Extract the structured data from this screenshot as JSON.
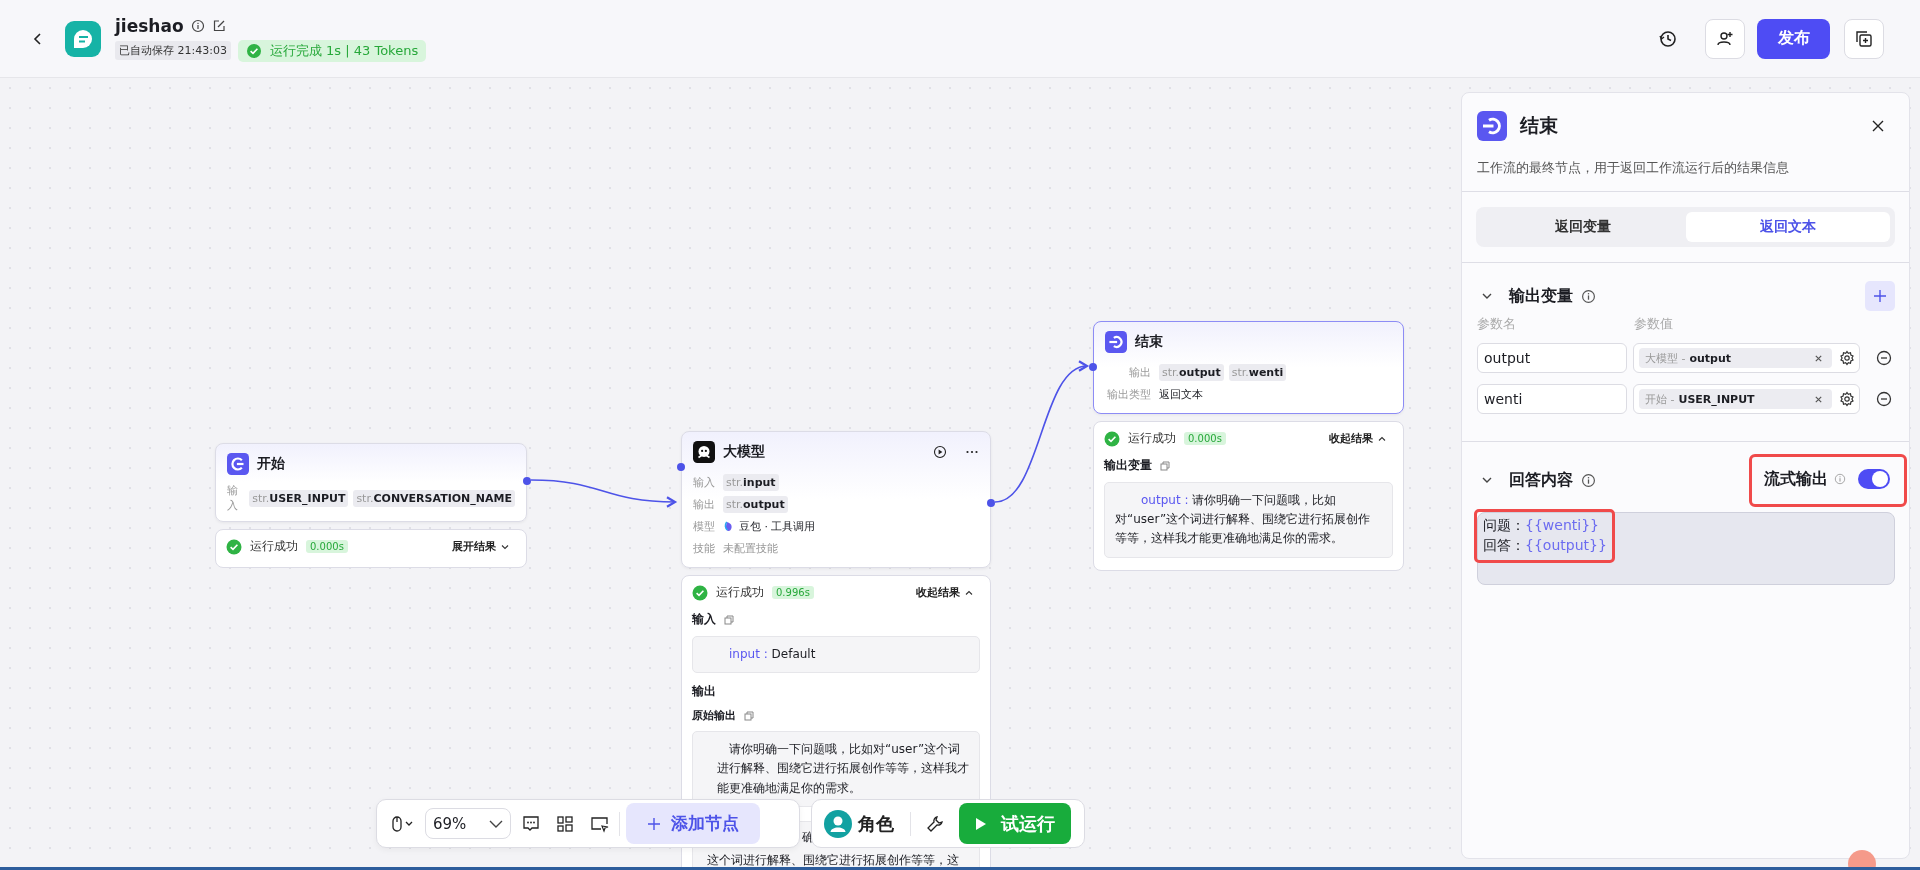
{
  "header": {
    "title": "jieshao",
    "autosave": "已自动保存 21:43:03",
    "run_status": "运行完成 1s | 43 Tokens",
    "publish": "发布"
  },
  "nodes": [
    {
      "kind": "start",
      "title": "开始",
      "rows": [
        {
          "label": "输入",
          "kind": "tags",
          "tags": [
            {
              "prefix": "str.",
              "name": "USER_INPUT"
            },
            {
              "prefix": "str.",
              "name": "CONVERSATION_NAME"
            }
          ]
        }
      ],
      "result": {
        "status": "运行成功",
        "time": "0.000s",
        "toggle": "展开结果",
        "expanded": false
      }
    },
    {
      "kind": "llm",
      "title": "大模型",
      "rows": [
        {
          "label": "输入",
          "kind": "tags",
          "tags": [
            {
              "prefix": "str.",
              "name": "input"
            }
          ]
        },
        {
          "label": "输出",
          "kind": "tags",
          "tags": [
            {
              "prefix": "str.",
              "name": "output"
            }
          ]
        },
        {
          "label": "模型",
          "kind": "model",
          "text": "豆包 · 工具调用"
        },
        {
          "label": "技能",
          "kind": "empty",
          "text": "未配置技能"
        }
      ],
      "result": {
        "status": "运行成功",
        "time": "0.996s",
        "toggle": "收起结果",
        "expanded": true,
        "sections": [
          {
            "heading": "输入",
            "kind": "kv",
            "key": "input :",
            "value": "Default"
          },
          {
            "heading": "输出",
            "kind": "raw",
            "subheading": "原始输出",
            "text": "请你明确一下问题哦，比如对“user”这个词进行解释、围绕它进行拓展创作等等，这样我才能更准确地满足你的需求。"
          }
        ],
        "tail": {
          "fragment": "确",
          "text": "这个词进行解释、围绕它进行拓展创作等等，这"
        }
      }
    },
    {
      "kind": "end",
      "title": "结束",
      "rows": [
        {
          "label": "输出",
          "kind": "tags",
          "tags": [
            {
              "prefix": "str.",
              "name": "output"
            },
            {
              "prefix": "str.",
              "name": "wenti"
            }
          ]
        },
        {
          "label": "输出类型",
          "kind": "text",
          "text": "返回文本"
        }
      ],
      "result": {
        "status": "运行成功",
        "time": "0.000s",
        "toggle": "收起结果",
        "expanded": true,
        "sections": [
          {
            "heading": "输出变量",
            "kind": "kv",
            "key": "output :",
            "value": "请你明确一下问题哦，比如对“user”这个词进行解释、围绕它进行拓展创作等等，这样我才能更准确地满足你的需求。"
          }
        ]
      }
    }
  ],
  "panel": {
    "title": "结束",
    "description": "工作流的最终节点，用于返回工作流运行后的结果信息",
    "tabs": [
      {
        "label": "返回变量",
        "selected": false
      },
      {
        "label": "返回文本",
        "selected": true
      }
    ],
    "output_section": {
      "title": "输出变量",
      "expanded": true,
      "columns": [
        "参数名",
        "参数值"
      ],
      "rows": [
        {
          "name": "output",
          "source": "大模型 -",
          "variable": "output"
        },
        {
          "name": "wenti",
          "source": "开始 -",
          "variable": "USER_INPUT"
        }
      ]
    },
    "answer_section": {
      "title": "回答内容",
      "expanded": true,
      "highlighted": true,
      "streaming": {
        "label": "流式输出",
        "on": true,
        "highlighted": true
      },
      "lines": [
        {
          "label": "问题：",
          "variable": "{{wenti}}"
        },
        {
          "label": "回答：",
          "variable": "{{output}}"
        }
      ]
    }
  },
  "toolbar": {
    "zoom": "69%",
    "add_node": "添加节点",
    "role": "角色",
    "test_run": "试运行"
  }
}
